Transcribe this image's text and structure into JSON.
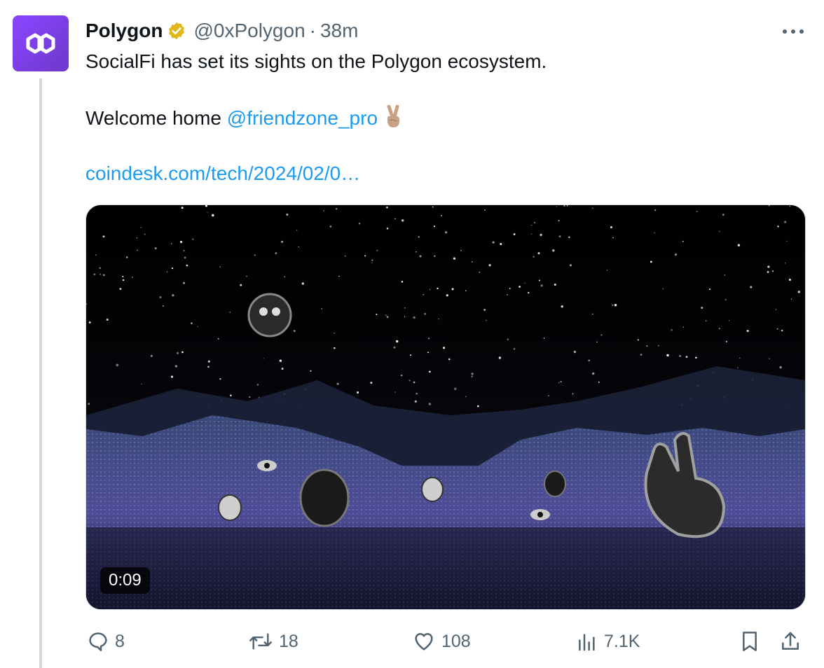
{
  "tweet": {
    "author": {
      "display_name": "Polygon",
      "handle": "@0xPolygon",
      "separator": "·",
      "time": "38m",
      "avatar_icon": "polygon-logo-icon",
      "avatar_color": "#8247e5",
      "verified_icon": "gold-verified-badge-icon",
      "verified_color": "#e2b719"
    },
    "text": {
      "line1": "SocialFi has set its sights on the Polygon ecosystem.",
      "line2_prefix": "Welcome home ",
      "mention": "@friendzone_pro",
      "emoji": "✌🏼",
      "url": "coindesk.com/tech/2024/02/0…"
    },
    "media": {
      "type": "video",
      "duration": "0:09"
    },
    "actions": {
      "replies": "8",
      "reposts": "18",
      "likes": "108",
      "views": "7.1K",
      "reply_icon": "reply-bubble-icon",
      "repost_icon": "repost-icon",
      "like_icon": "heart-icon",
      "views_icon": "analytics-bars-icon",
      "bookmark_icon": "bookmark-icon",
      "share_icon": "share-icon"
    },
    "colors": {
      "link": "#1d9bf0",
      "secondary_text": "#536471"
    }
  }
}
